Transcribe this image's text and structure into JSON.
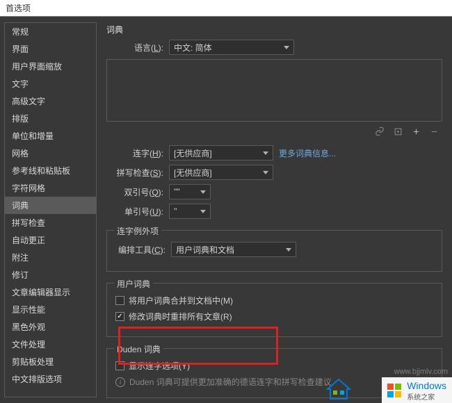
{
  "titlebar": {
    "title": "首选项"
  },
  "sidebar": {
    "items": [
      {
        "label": "常规"
      },
      {
        "label": "界面"
      },
      {
        "label": "用户界面缩放"
      },
      {
        "label": "文字"
      },
      {
        "label": "高级文字"
      },
      {
        "label": "排版"
      },
      {
        "label": "单位和增量"
      },
      {
        "label": "网格"
      },
      {
        "label": "参考线和粘贴板"
      },
      {
        "label": "字符网格"
      },
      {
        "label": "词典"
      },
      {
        "label": "拼写检查"
      },
      {
        "label": "自动更正"
      },
      {
        "label": "附注"
      },
      {
        "label": "修订"
      },
      {
        "label": "文章编辑器显示"
      },
      {
        "label": "显示性能"
      },
      {
        "label": "黑色外观"
      },
      {
        "label": "文件处理"
      },
      {
        "label": "剪贴板处理"
      },
      {
        "label": "中文排版选项"
      }
    ],
    "selectedIndex": 10
  },
  "dict": {
    "heading": "词典",
    "language_label_pre": "语言(",
    "language_label_key": "L",
    "language_label_post": "):",
    "language_value": "中文: 简体",
    "hyphen_label_pre": "连字(",
    "hyphen_label_key": "H",
    "hyphen_label_post": "):",
    "hyphen_value": "[无供应商]",
    "more_info": "更多词典信息...",
    "spell_label_pre": "拼写检查(",
    "spell_label_key": "S",
    "spell_label_post": "):",
    "spell_value": "[无供应商]",
    "dquote_label_pre": "双引号(",
    "dquote_label_key": "Q",
    "dquote_label_post": "):",
    "dquote_value": "\"\"",
    "squote_label_pre": "单引号(",
    "squote_label_key": "U",
    "squote_label_post": "):",
    "squote_value": "''"
  },
  "exceptions": {
    "legend": "连字例外项",
    "compose_label_pre": "编排工具(",
    "compose_label_key": "C",
    "compose_label_post": "):",
    "compose_value": "用户词典和文档"
  },
  "userdict": {
    "legend": "用户词典",
    "merge_text_pre": "将用户词典合并到文档中(",
    "merge_text_key": "M",
    "merge_text_post": ")",
    "merge_checked": false,
    "recompose_text_pre": "修改词典时重排所有文章(",
    "recompose_text_key": "R",
    "recompose_text_post": ")",
    "recompose_checked": true
  },
  "duden": {
    "legend": "Duden 词典",
    "show_text_pre": "显示连字选项(",
    "show_text_key": "Y",
    "show_text_post": ")",
    "show_checked": false,
    "info_text": "Duden 词典可提供更加准确的德语连字和拼写检查建议"
  },
  "watermark": {
    "brand": "Windows",
    "sub": "系统之家",
    "url": "www.bjjmlv.com"
  }
}
